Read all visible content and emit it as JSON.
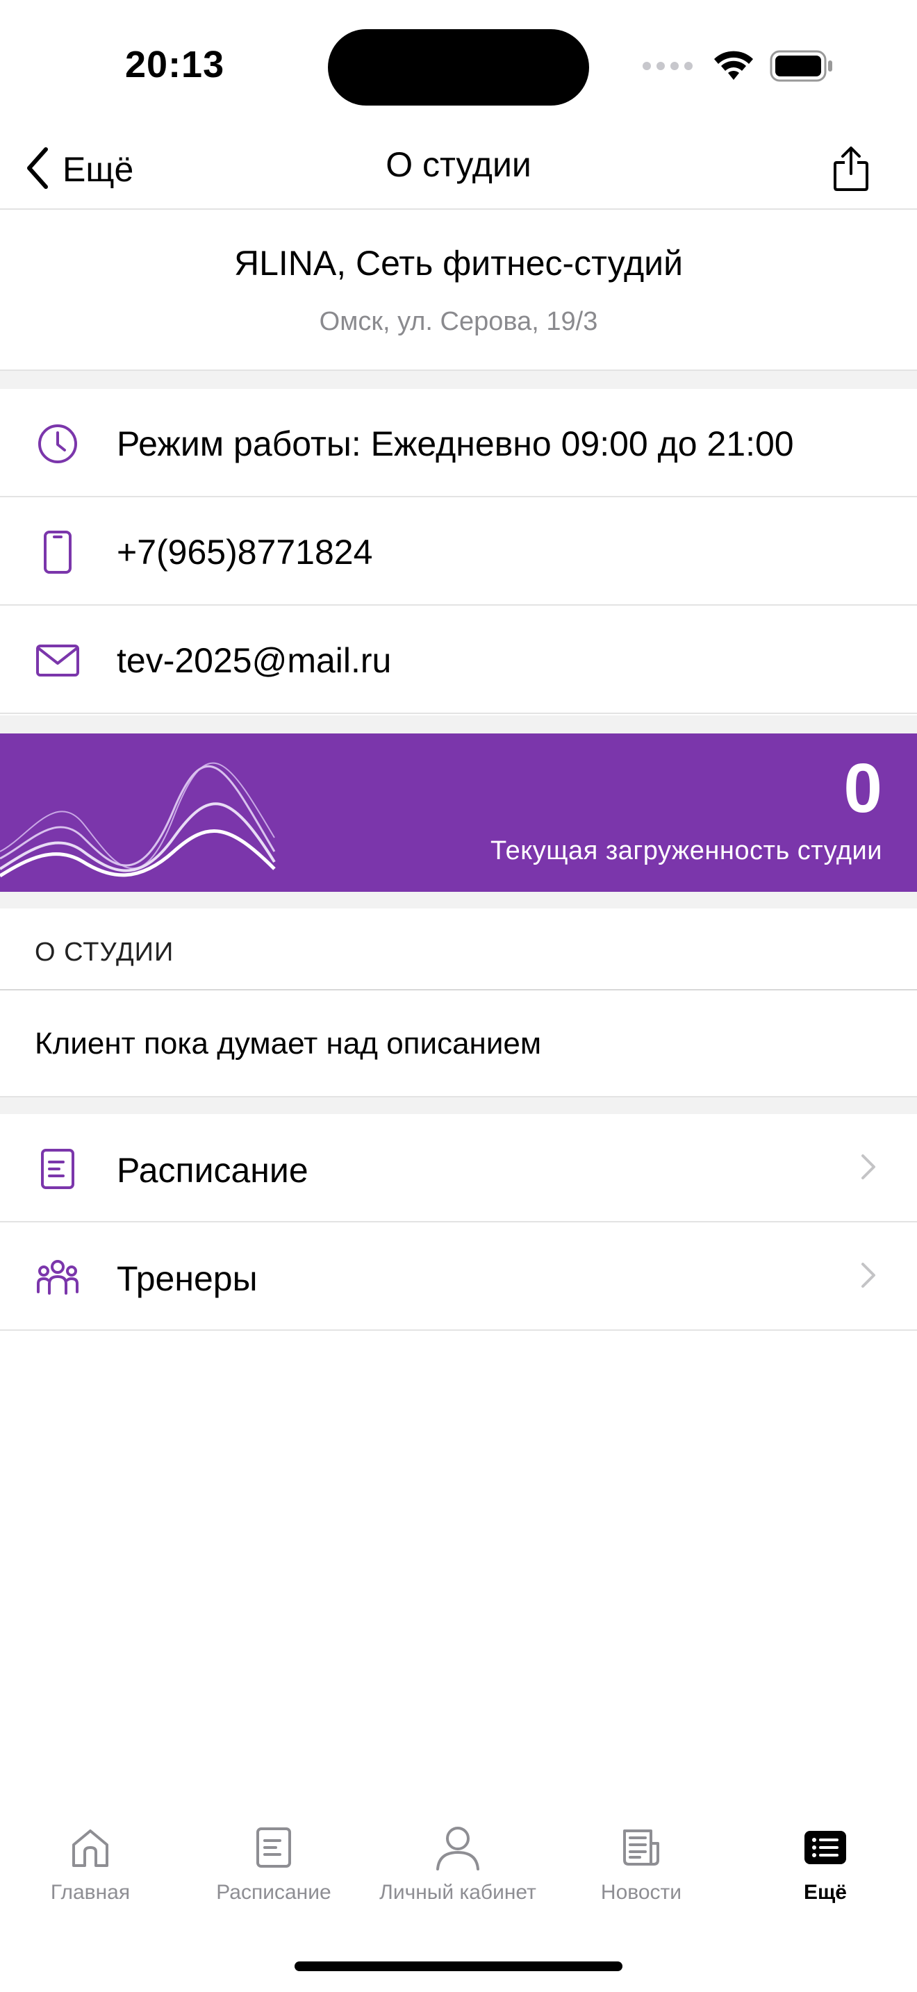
{
  "status_bar": {
    "time": "20:13"
  },
  "nav": {
    "back_label": "Ещё",
    "title": "О студии"
  },
  "studio": {
    "name": "ЯLINA, Сеть фитнес-студий",
    "address": "Омск, ул. Серова, 19/3"
  },
  "info": {
    "hours": "Режим работы: Ежедневно 09:00 до 21:00",
    "phone": "+7(965)8771824",
    "email": "tev-2025@mail.ru"
  },
  "load": {
    "value": "0",
    "caption": "Текущая загруженность студии"
  },
  "about": {
    "header": "О СТУДИИ",
    "text": "Клиент пока думает над описанием"
  },
  "menu": [
    {
      "label": "Расписание",
      "icon": "document-icon"
    },
    {
      "label": "Тренеры",
      "icon": "people-icon"
    }
  ],
  "tabs": [
    {
      "label": "Главная",
      "icon": "home-icon"
    },
    {
      "label": "Расписание",
      "icon": "document-icon"
    },
    {
      "label": "Личный кабинет",
      "icon": "person-icon"
    },
    {
      "label": "Новости",
      "icon": "newspaper-icon"
    },
    {
      "label": "Ещё",
      "icon": "list-icon",
      "active": true
    }
  ],
  "colors": {
    "accent": "#7B36AB",
    "separator": "#E3E3E3",
    "secondary_text": "#8A8A8E",
    "tab_inactive": "#8E8E93"
  }
}
